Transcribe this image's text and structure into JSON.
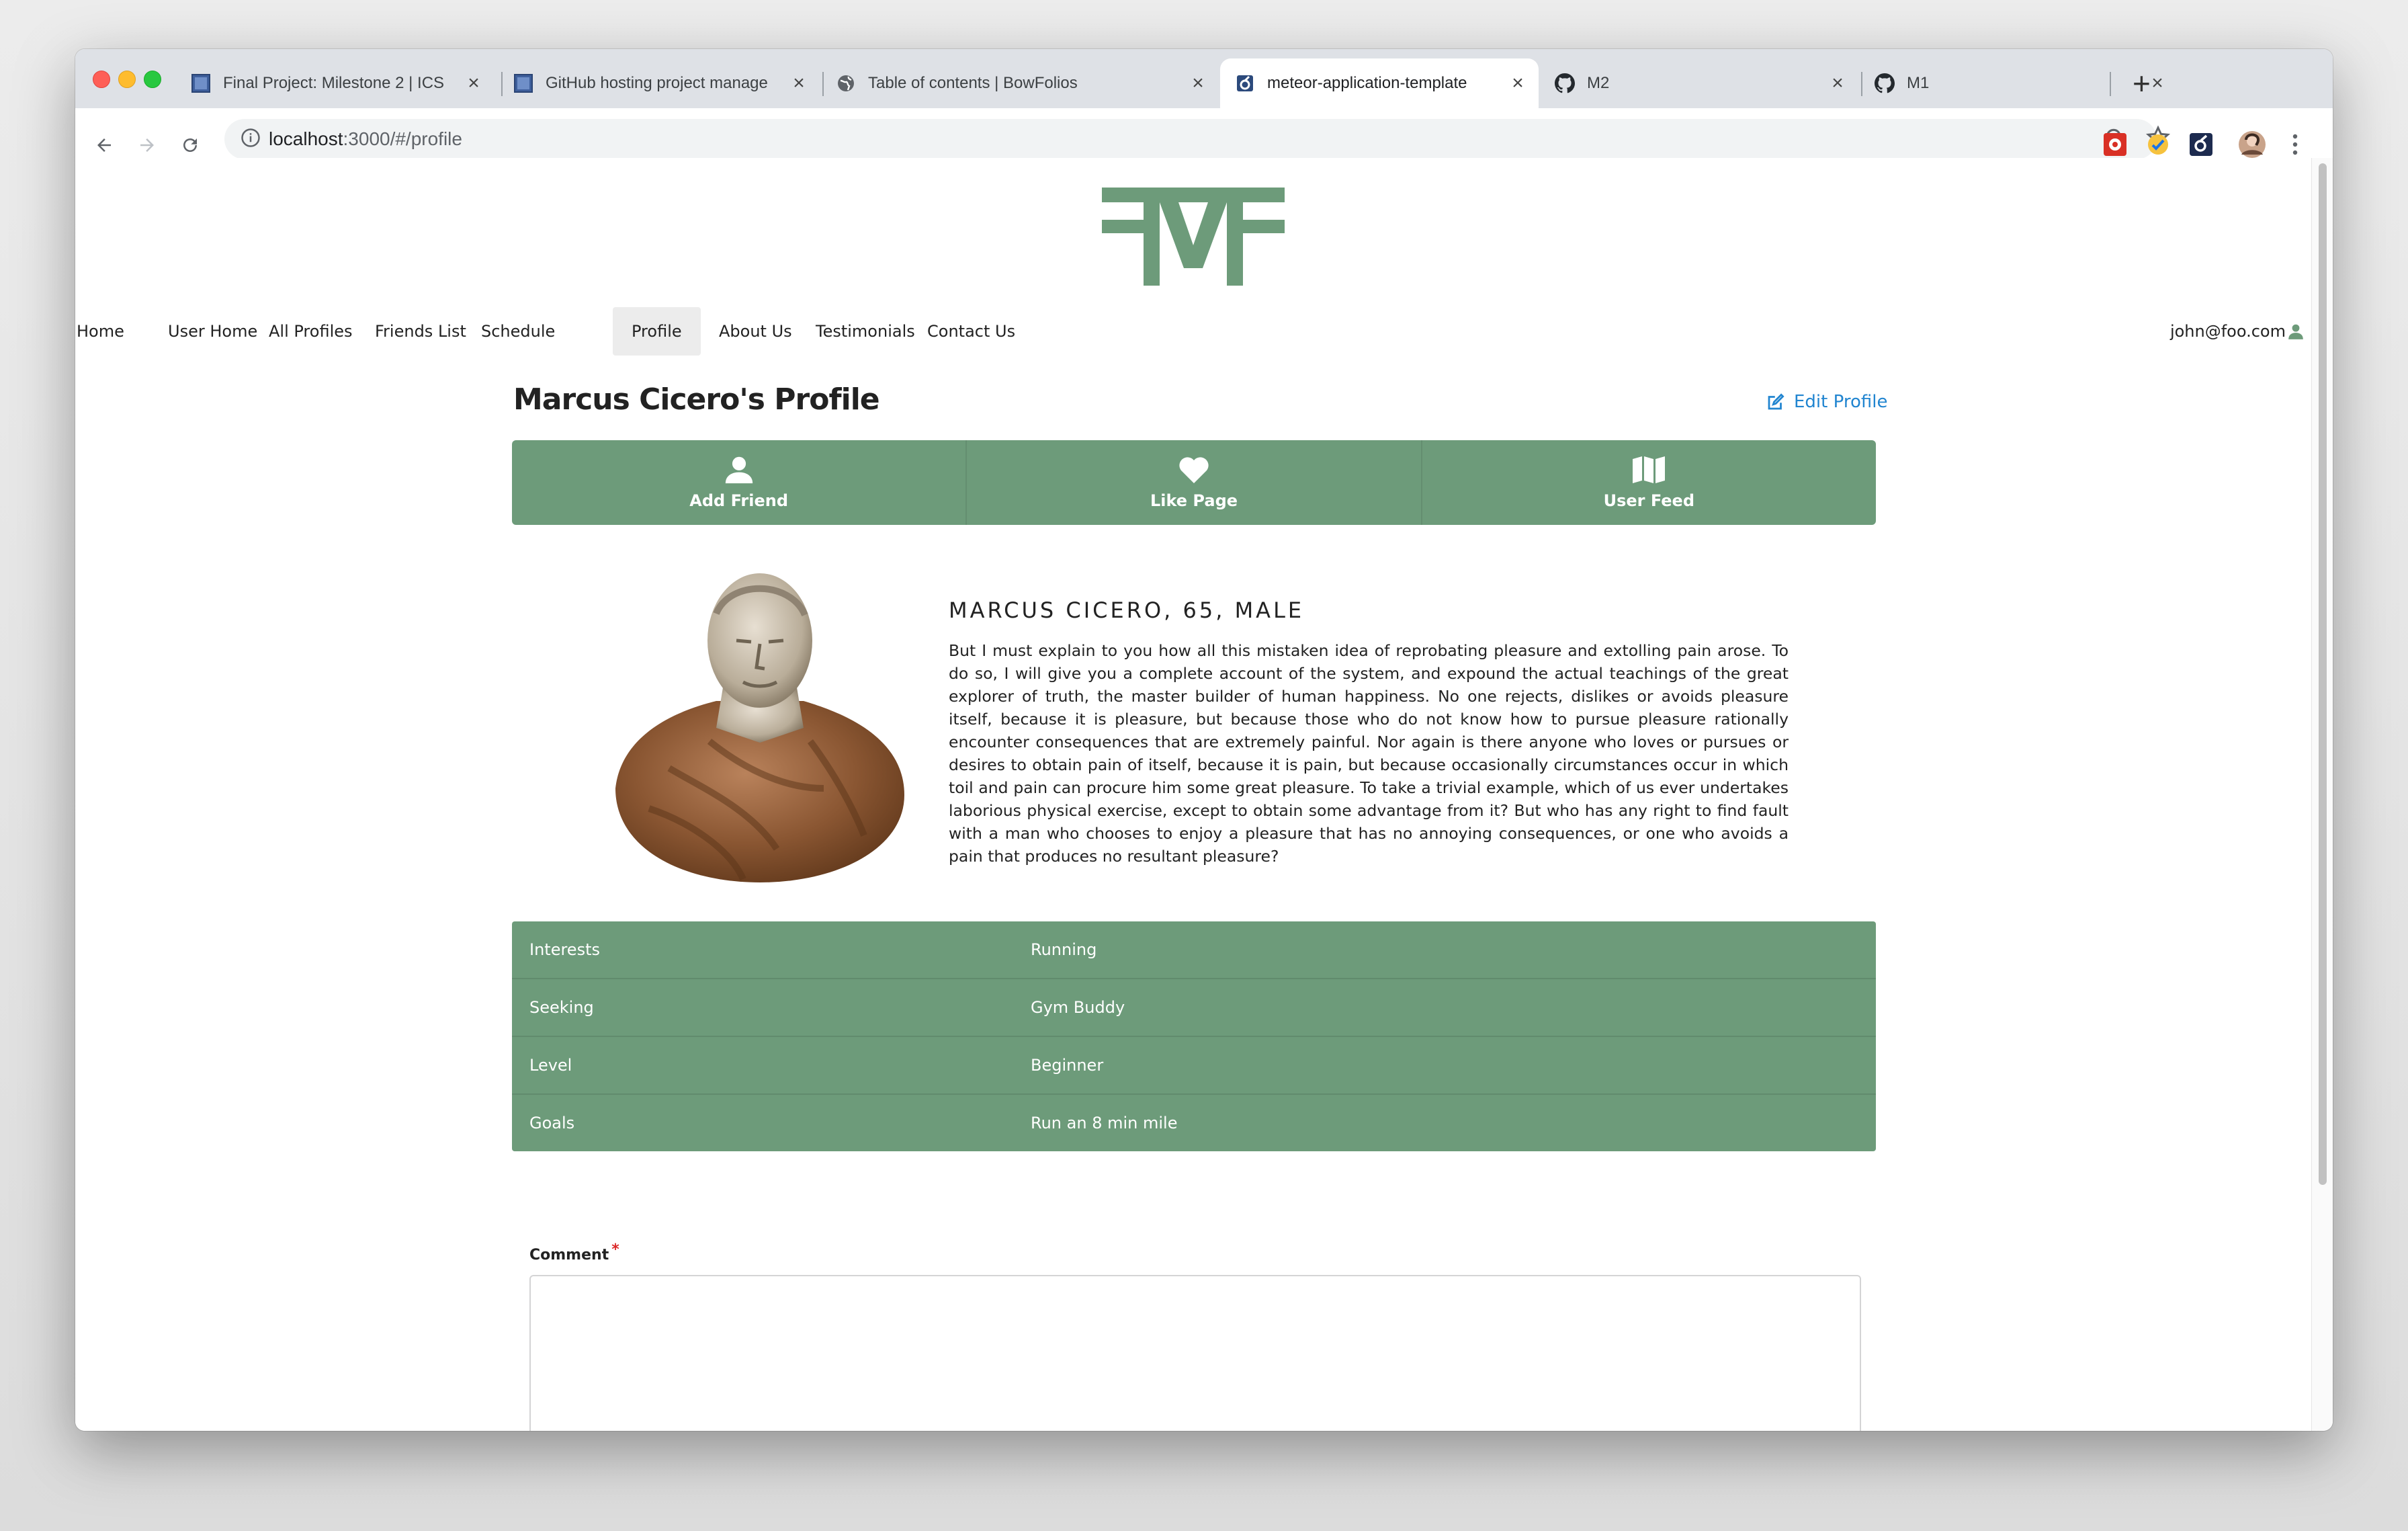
{
  "browser": {
    "tabs": [
      {
        "title": "Final Project: Milestone 2 | ICS",
        "favicon": "blue-square-icon",
        "active": false
      },
      {
        "title": "GitHub hosting project manage",
        "favicon": "blue-square-icon",
        "active": false
      },
      {
        "title": "Table of contents | BowFolios",
        "favicon": "globe-icon",
        "active": false
      },
      {
        "title": "meteor-application-template",
        "favicon": "meteor-icon",
        "active": true
      },
      {
        "title": "M2",
        "favicon": "github-icon",
        "active": false
      },
      {
        "title": "M1",
        "favicon": "github-icon",
        "active": false
      }
    ],
    "new_tab_label": "+",
    "url_host": "localhost",
    "url_path": ":3000/#/profile"
  },
  "nav": {
    "items": [
      "Home",
      "User Home",
      "All Profiles",
      "Friends List",
      "Schedule",
      "Profile",
      "About Us",
      "Testimonials",
      "Contact Us"
    ],
    "active": "Profile",
    "user_email": "john@foo.com"
  },
  "profile": {
    "title": "Marcus Cicero's Profile",
    "edit_label": "Edit Profile",
    "actions": [
      {
        "label": "Add Friend",
        "icon": "user-icon"
      },
      {
        "label": "Like Page",
        "icon": "heart-icon"
      },
      {
        "label": "User Feed",
        "icon": "map-icon"
      }
    ],
    "heading": "MARCUS CICERO, 65, MALE",
    "bio": "But I must explain to you how all this mistaken idea of reprobating pleasure and extolling pain arose. To do so, I will give you a complete account of the system, and expound the actual teachings of the great explorer of truth, the master builder of human happiness. No one rejects, dislikes or avoids pleasure itself, because it is pleasure, but because those who do not know how to pursue pleasure rationally encounter consequences that are extremely painful. Nor again is there anyone who loves or pursues or desires to obtain pain of itself, because it is pain, but because occasionally circumstances occur in which toil and pain can procure him some great pleasure. To take a trivial example, which of us ever undertakes laborious physical exercise, except to obtain some advantage from it? But who has any right to find fault with a man who chooses to enjoy a pleasure that has no annoying consequences, or one who avoids a pain that produces no resultant pleasure?",
    "details": [
      {
        "label": "Interests",
        "value": "Running"
      },
      {
        "label": "Seeking",
        "value": "Gym Buddy"
      },
      {
        "label": "Level",
        "value": "Beginner"
      },
      {
        "label": "Goals",
        "value": "Run an 8 min mile"
      }
    ],
    "comment_label": "Comment",
    "required_mark": "*",
    "comment_value": ""
  },
  "colors": {
    "brand_green": "#6d9b7a",
    "link_blue": "#2185d0"
  }
}
